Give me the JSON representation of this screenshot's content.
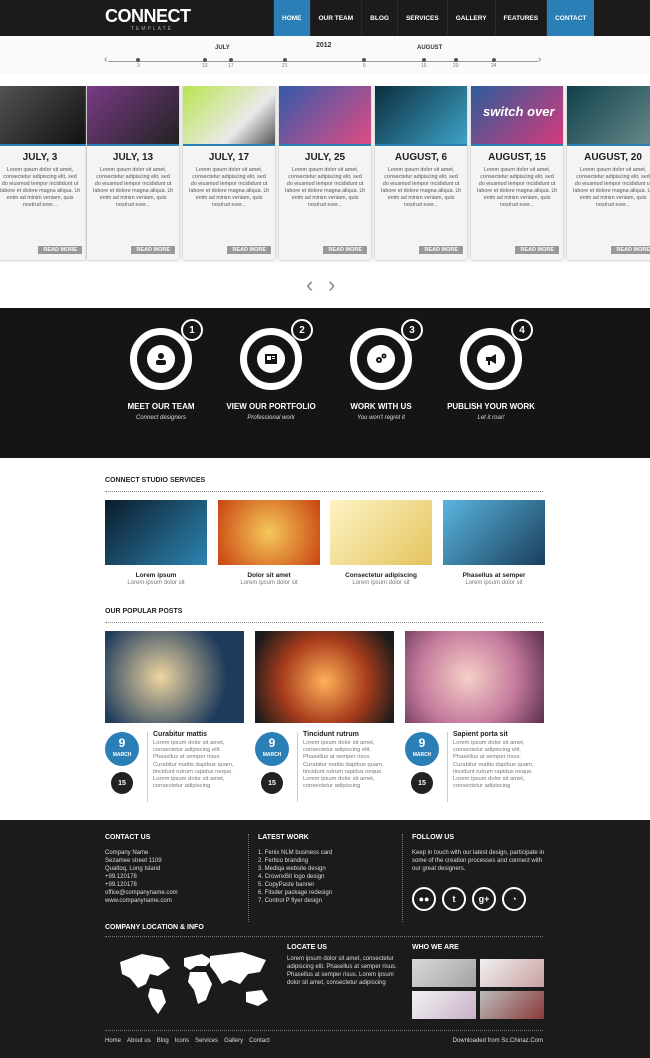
{
  "header": {
    "logo": "CONNECT",
    "logo_sub": "TEMPLATE",
    "nav": [
      {
        "label": "HOME",
        "active": true
      },
      {
        "label": "OUR TEAM"
      },
      {
        "label": "BLOG"
      },
      {
        "label": "SERVICES"
      },
      {
        "label": "GALLERY"
      },
      {
        "label": "FEATURES"
      },
      {
        "label": "CONTACT",
        "contact": true
      }
    ]
  },
  "timeline": {
    "year": "2012",
    "months": [
      "JULY",
      "AUGUST"
    ],
    "ticks": [
      "3",
      "13",
      "17",
      "21",
      "6",
      "15",
      "20",
      "24"
    ]
  },
  "cards": [
    {
      "date": "JULY, 3",
      "text": "Lorem ipsum dolor sit amet, consectetur adipiscing elit, sed do eiusmod tempor incididunt ut labore et dolore magna aliqua. Ut enim ad minim veniam, quis nostrud exer...",
      "more": "READ MORE",
      "color": "#2c2c2c"
    },
    {
      "date": "JULY, 13",
      "text": "Lorem ipsum dolor sit amet, consectetur adipiscing elit, sed do eiusmod tempor incididunt ut labore et dolore magna aliqua. Ut enim ad minim veniam, quis nostrud exer...",
      "more": "READ MORE",
      "color": "#7a3b86"
    },
    {
      "date": "JULY, 17",
      "text": "Lorem ipsum dolor sit amet, consectetur adipiscing elit, sed do eiusmod tempor incididunt ut labore et dolore magna aliqua. Ut enim ad minim veniam, quis nostrud exer...",
      "more": "READ MORE",
      "color": "#8ec53f"
    },
    {
      "date": "JULY, 25",
      "text": "Lorem ipsum dolor sit amet, consectetur adipiscing elit, sed do eiusmod tempor incididunt ut labore et dolore magna aliqua. Ut enim ad minim veniam, quis nostrud exer...",
      "more": "READ MORE",
      "color": "#5a76b6"
    },
    {
      "date": "AUGUST, 6",
      "text": "Lorem ipsum dolor sit amet, consectetur adipiscing elit, sed do eiusmod tempor incididunt ut labore et dolore magna aliqua. Ut enim ad minim veniam, quis nostrud exer...",
      "more": "READ MORE",
      "color": "#1c4d6b"
    },
    {
      "date": "AUGUST, 15",
      "text": "Lorem ipsum dolor sit amet, consectetur adipiscing elit, sed do eiusmod tempor incididunt ut labore et dolore magna aliqua. Ut enim ad minim veniam, quis nostrud exer...",
      "more": "READ MORE",
      "color": "#8c2f5c",
      "img_text": "switch over"
    },
    {
      "date": "AUGUST, 20",
      "text": "Lorem ipsum dolor sit amet, consectetur adipiscing elit, sed do eiusmod tempor incididunt ut labore et dolore magna aliqua. Ut enim ad minim veniam, quis nostrud exer...",
      "more": "READ MORE",
      "color": "#174e5c"
    }
  ],
  "steps": [
    {
      "num": "1",
      "title": "MEET OUR TEAM",
      "sub": "Connect designers",
      "icon": "user-icon"
    },
    {
      "num": "2",
      "title": "VIEW OUR PORTFOLIO",
      "sub": "Professional work",
      "icon": "portfolio-icon"
    },
    {
      "num": "3",
      "title": "WORK WITH US",
      "sub": "You won't regret it",
      "icon": "gears-icon"
    },
    {
      "num": "4",
      "title": "PUBLISH YOUR WORK",
      "sub": "Let it roar!",
      "icon": "megaphone-icon"
    }
  ],
  "services": {
    "title": "CONNECT STUDIO SERVICES",
    "items": [
      {
        "title": "Lorem ipsum",
        "desc": "Lorem ipsum dolor sit",
        "color": "#1d4b64"
      },
      {
        "title": "Dolor sit amet",
        "desc": "Lorem ipsum dolor sit",
        "color": "#e58b16"
      },
      {
        "title": "Consectetur adipiscing",
        "desc": "Lorem ipsum dolor sit",
        "color": "#f2e6a3"
      },
      {
        "title": "Phasellus at semper",
        "desc": "Lorem ipsum dolor sit",
        "color": "#2b84a8"
      }
    ]
  },
  "posts": {
    "title": "OUR POPULAR POSTS",
    "items": [
      {
        "title": "Curabitur mattis",
        "day": "9",
        "month": "MARCH",
        "comments": "15",
        "color": "#1e3b5c",
        "excerpt": "Lorem ipsum dolor sit amet, consectetur adipiscing elit. Phasellus at semper risus. Curabitur mattis dapibus quam, tincidunt rutrum rapidus neque. Lorem ipsum dolor sit amet, consectetur adipiscing"
      },
      {
        "title": "Tincidunt rutrum",
        "day": "9",
        "month": "MARCH",
        "comments": "15",
        "color": "#a83c1c",
        "excerpt": "Lorem ipsum dolor sit amet, consectetur adipiscing elit. Phasellus at semper risus. Curabitur mattis dapibus quam, tincidunt rutrum rapidus neque. Lorem ipsum dolor sit amet, consectetur adipiscing"
      },
      {
        "title": "Sapient porta sit",
        "day": "9",
        "month": "MARCH",
        "comments": "15",
        "color": "#c47a9c",
        "excerpt": "Lorem ipsum dolor sit amet, consectetur adipiscing elit. Phasellus at semper risus. Curabitur mattis dapibus quam, tincidunt rutrum rapidus neque. Lorem ipsum dolor sit amet, consectetur adipiscing"
      }
    ]
  },
  "footer": {
    "contact": {
      "title": "CONTACT US",
      "lines": [
        "Company Name",
        "Sezamee street 1109",
        "Qualtoq, Long Island",
        "+99.120178",
        "+99.120178",
        "office@companyname.com",
        "www.companyname.com"
      ]
    },
    "latest": {
      "title": "LATEST WORK",
      "lines": [
        "1. Fenix NLM business card",
        "2. Fertico branding",
        "3. Mediqa website design",
        "4. CrownxBit logo design",
        "5. CopyPaste banner",
        "6. Fitsder package redesign",
        "7. Control P flyer design"
      ]
    },
    "follow": {
      "title": "FOLLOW US",
      "text": "Keep in touch with our latest design, participate in some of the creation processes and connect with our great designers.",
      "icons": [
        "flickr-icon",
        "twitter-icon",
        "googleplus-icon",
        "rss-icon"
      ]
    },
    "location_title": "COMPANY LOCATION & INFO",
    "locate": {
      "title": "LOCATE US",
      "text": "Lorem ipsum dolor sit amet, consectetur adipiscing elit. Phasellus at semper risus. Phasellus at semper risus. Lorem ipsum dolor sit amet, consectetur adipiscing"
    },
    "who": {
      "title": "WHO WE ARE"
    },
    "bottom_nav": [
      "Home",
      "About us",
      "Blog",
      "Icons",
      "Services",
      "Gallery",
      "Contact"
    ],
    "credit": "Downloaded from Sc.Chinaz.Com"
  }
}
